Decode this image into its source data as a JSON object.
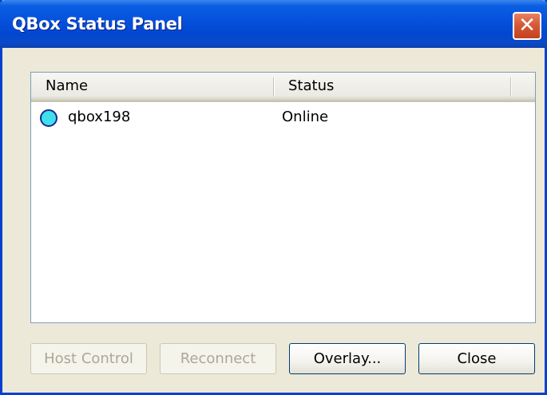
{
  "window": {
    "title": "QBox Status Panel",
    "close_glyph": "✕"
  },
  "list": {
    "columns": [
      "Name",
      "Status"
    ],
    "rows": [
      {
        "name": "qbox198",
        "status": "Online",
        "status_icon": "circle-icon",
        "status_color": "#3fe0ee"
      }
    ]
  },
  "buttons": {
    "host_control": {
      "label": "Host Control",
      "enabled": false
    },
    "reconnect": {
      "label": "Reconnect",
      "enabled": false
    },
    "overlay": {
      "label": "Overlay...",
      "enabled": true
    },
    "close": {
      "label": "Close",
      "enabled": true
    }
  },
  "colors": {
    "titlebar": "#0550db",
    "close_button": "#d65a38",
    "window_face": "#ece9d8"
  }
}
